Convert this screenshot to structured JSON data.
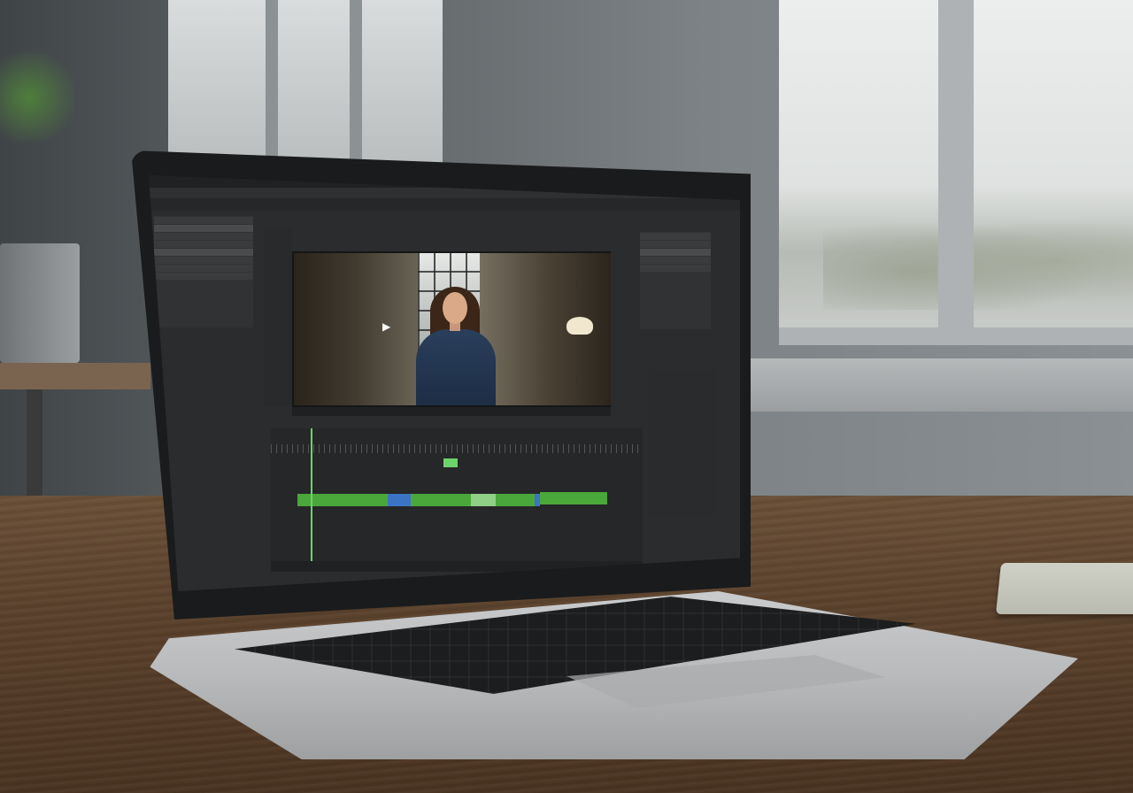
{
  "scene": {
    "description_colors": {
      "accent_green": "#4aa83a",
      "clip_blue": "#3b74c4",
      "ui_dark": "#2b2c2d"
    }
  },
  "app": {
    "menu": [],
    "icons": [
      "play-icon"
    ]
  }
}
